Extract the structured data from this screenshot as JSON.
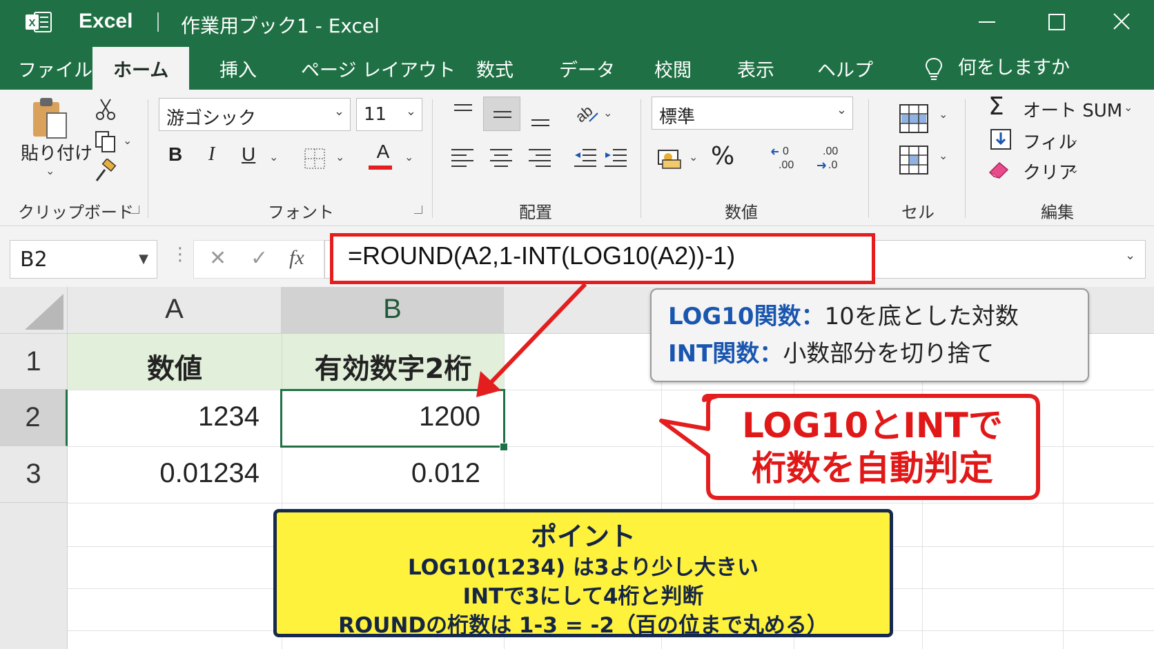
{
  "titlebar": {
    "app_name": "Excel",
    "document_title": "作業用ブック1 - Excel"
  },
  "tabs": [
    {
      "label": "ファイル",
      "active": false
    },
    {
      "label": "ホーム",
      "active": true
    },
    {
      "label": "挿入",
      "active": false
    },
    {
      "label": "ページ レイアウト",
      "active": false
    },
    {
      "label": "数式",
      "active": false
    },
    {
      "label": "データ",
      "active": false
    },
    {
      "label": "校閲",
      "active": false
    },
    {
      "label": "表示",
      "active": false
    },
    {
      "label": "ヘルプ",
      "active": false
    }
  ],
  "tell_me": "何をしますか",
  "ribbon": {
    "clipboard": {
      "paste_label": "貼り付け",
      "group_label": "クリップボード"
    },
    "font": {
      "font_name": "游ゴシック",
      "font_size": "11",
      "bold": "B",
      "italic": "I",
      "underline": "U",
      "font_color_letter": "A",
      "group_label": "フォント"
    },
    "alignment": {
      "group_label": "配置"
    },
    "number": {
      "format": "標準",
      "percent": "%",
      "group_label": "数値"
    },
    "cells": {
      "group_label": "セル"
    },
    "editing": {
      "autosum": "オート SUM",
      "fill": "フィル",
      "clear": "クリア",
      "group_label": "編集"
    }
  },
  "formula_bar": {
    "name_box": "B2",
    "fx": "fx",
    "formula": "=ROUND(A2,1-INT(LOG10(A2))-1)"
  },
  "grid": {
    "columns": [
      "A",
      "B"
    ],
    "rows": [
      "1",
      "2",
      "3"
    ],
    "header_row": [
      "数値",
      "有効数字2桁"
    ],
    "data_rows": [
      [
        "1234",
        "1200"
      ],
      [
        "0.01234",
        "0.012"
      ]
    ],
    "selected_cell": "B2"
  },
  "annotations": {
    "info": [
      {
        "key": "LOG10関数：",
        "value": "10を底とした対数"
      },
      {
        "key": "INT関数：",
        "value": "小数部分を切り捨て"
      }
    ],
    "callout": [
      "LOG10とINTで",
      "桁数を自動判定"
    ],
    "point": {
      "title": "ポイント",
      "lines": [
        "LOG10(1234) は3より少し大きい",
        "INTで3にして4桁と判断",
        "ROUNDの桁数は 1-3 = -2（百の位まで丸める）"
      ]
    }
  },
  "colors": {
    "excel_green": "#1f7145",
    "highlight_red": "#e41e1e",
    "header_fill": "#e2efda",
    "point_yellow": "#fff23c",
    "info_blue": "#1a56b0"
  }
}
